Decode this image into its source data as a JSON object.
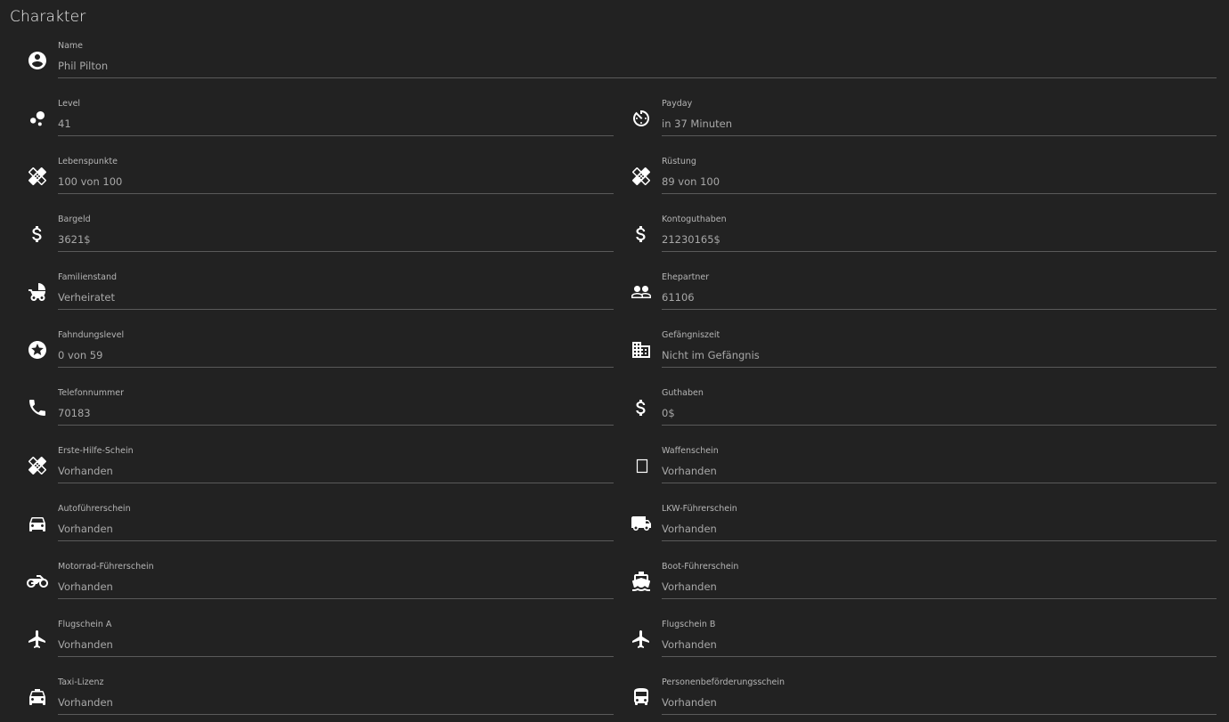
{
  "page": {
    "title": "Charakter"
  },
  "fields": {
    "name": {
      "label": "Name",
      "value": "Phil Pilton",
      "icon": "account-circle-icon"
    },
    "level": {
      "label": "Level",
      "value": "41",
      "icon": "bubbles-icon"
    },
    "payday": {
      "label": "Payday",
      "value": "in 37 Minuten",
      "icon": "timer-icon"
    },
    "health": {
      "label": "Lebenspunkte",
      "value": "100 von 100",
      "icon": "healing-icon"
    },
    "armor": {
      "label": "Rüstung",
      "value": "89 von 100",
      "icon": "healing-icon"
    },
    "cash": {
      "label": "Bargeld",
      "value": "3621$",
      "icon": "dollar-icon"
    },
    "bank": {
      "label": "Kontoguthaben",
      "value": "21230165$",
      "icon": "dollar-icon"
    },
    "marital": {
      "label": "Familienstand",
      "value": "Verheiratet",
      "icon": "stroller-icon"
    },
    "spouse": {
      "label": "Ehepartner",
      "value": "61106",
      "icon": "people-icon"
    },
    "wanted": {
      "label": "Fahndungslevel",
      "value": "0 von 59",
      "icon": "star-circle-icon"
    },
    "jail": {
      "label": "Gefängniszeit",
      "value": "Nicht im Gefängnis",
      "icon": "building-icon"
    },
    "phone": {
      "label": "Telefonnummer",
      "value": "70183",
      "icon": "phone-icon"
    },
    "credit": {
      "label": "Guthaben",
      "value": "0$",
      "icon": "dollar-icon"
    },
    "firstaid": {
      "label": "Erste-Hilfe-Schein",
      "value": "Vorhanden",
      "icon": "healing-icon"
    },
    "weapon": {
      "label": "Waffenschein",
      "value": "Vorhanden",
      "icon": "missing-glyph-icon"
    },
    "car": {
      "label": "Autoführerschein",
      "value": "Vorhanden",
      "icon": "car-icon"
    },
    "truck": {
      "label": "LKW-Führerschein",
      "value": "Vorhanden",
      "icon": "truck-icon"
    },
    "motorcycle": {
      "label": "Motorrad-Führerschein",
      "value": "Vorhanden",
      "icon": "motorcycle-icon"
    },
    "boat": {
      "label": "Boot-Führerschein",
      "value": "Vorhanden",
      "icon": "boat-icon"
    },
    "flightA": {
      "label": "Flugschein A",
      "value": "Vorhanden",
      "icon": "airplane-icon"
    },
    "flightB": {
      "label": "Flugschein B",
      "value": "Vorhanden",
      "icon": "airplane-icon"
    },
    "taxi": {
      "label": "Taxi-Lizenz",
      "value": "Vorhanden",
      "icon": "taxi-icon"
    },
    "passenger": {
      "label": "Personenbeförderungsschein",
      "value": "Vorhanden",
      "icon": "bus-icon"
    }
  },
  "colors": {
    "background": "#222222",
    "label": "#b5b5b5",
    "value": "#a8a8a8",
    "underline": "#5a5a5a",
    "icon": "#ffffff"
  }
}
